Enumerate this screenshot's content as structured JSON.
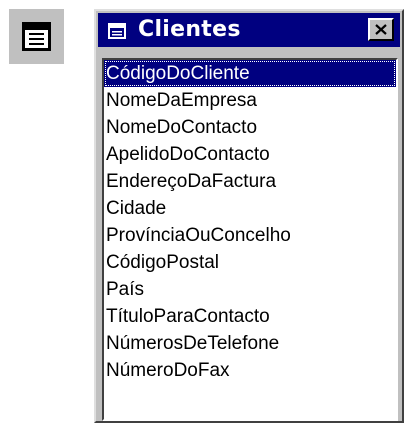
{
  "toolbar": {
    "button_icon": "field-list-icon"
  },
  "window": {
    "title": "Clientes",
    "title_icon": "table-icon",
    "close_icon": "close-icon",
    "colors": {
      "title_bar": "#000080",
      "chrome": "#c0c0c0",
      "selection": "#000080"
    }
  },
  "fields": [
    {
      "label": "CódigoDoCliente",
      "selected": true
    },
    {
      "label": "NomeDaEmpresa",
      "selected": false
    },
    {
      "label": "NomeDoContacto",
      "selected": false
    },
    {
      "label": "ApelidoDoContacto",
      "selected": false
    },
    {
      "label": "EndereçoDaFactura",
      "selected": false
    },
    {
      "label": "Cidade",
      "selected": false
    },
    {
      "label": "ProvínciaOuConcelho",
      "selected": false
    },
    {
      "label": "CódigoPostal",
      "selected": false
    },
    {
      "label": "País",
      "selected": false
    },
    {
      "label": "TítuloParaContacto",
      "selected": false
    },
    {
      "label": "NúmerosDeTelefone",
      "selected": false
    },
    {
      "label": "NúmeroDoFax",
      "selected": false
    }
  ]
}
